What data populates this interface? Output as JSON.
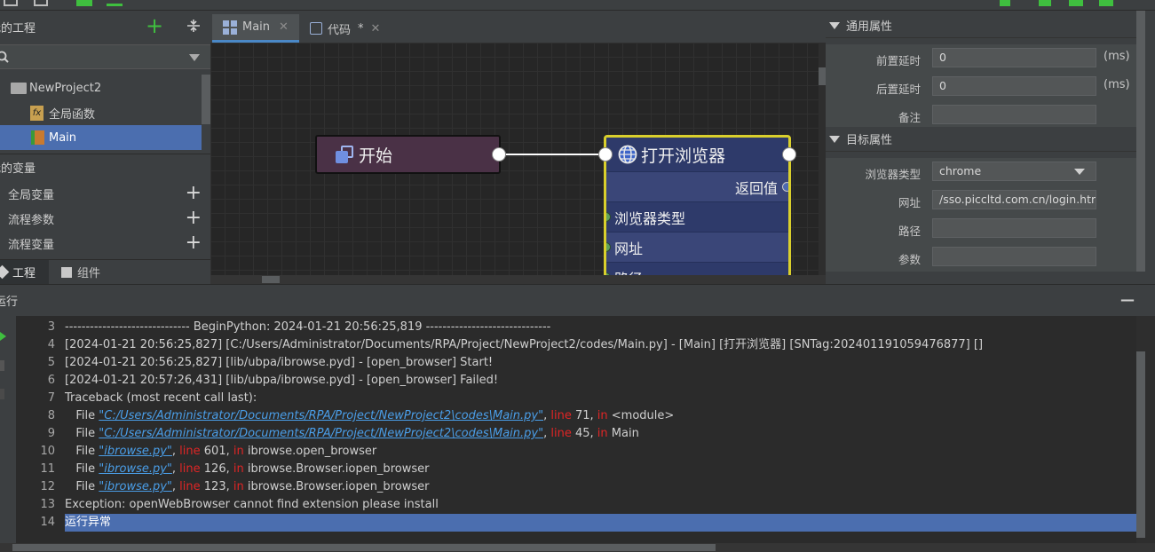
{
  "left_panel": {
    "project_header": "我的工程",
    "tree": [
      {
        "label": "NewProject2",
        "icon": "folder-icon"
      },
      {
        "label": "全局函数",
        "icon": "function-icon"
      },
      {
        "label": "Main",
        "icon": "flow-icon",
        "selected": true
      }
    ],
    "variables_header": "我的变量",
    "variables": [
      {
        "label": "全局变量"
      },
      {
        "label": "流程参数"
      },
      {
        "label": "流程变量"
      }
    ],
    "bottom_tabs": [
      {
        "label": "工程"
      },
      {
        "label": "组件"
      }
    ]
  },
  "editor_tabs": [
    {
      "label": "Main",
      "close": "✕"
    },
    {
      "label": "代码",
      "modified": "*",
      "close": "✕"
    }
  ],
  "nodes": {
    "start": {
      "label": "开始"
    },
    "browser": {
      "title": "打开浏览器",
      "output_port": "返回值",
      "inputs": [
        "浏览器类型",
        "网址",
        "路径"
      ]
    }
  },
  "properties": {
    "general_header": "通用属性",
    "general": [
      {
        "label": "前置延时",
        "value": "0",
        "unit": "(ms)"
      },
      {
        "label": "后置延时",
        "value": "0",
        "unit": "(ms)"
      },
      {
        "label": "备注",
        "value": ""
      }
    ],
    "target_header": "目标属性",
    "target": [
      {
        "label": "浏览器类型",
        "value": "chrome"
      },
      {
        "label": "网址",
        "value": "/sso.piccltd.com.cn/login.html'"
      },
      {
        "label": "路径",
        "value": ""
      },
      {
        "label": "参数",
        "value": ""
      }
    ]
  },
  "output": {
    "title": "运行",
    "minimize": "—",
    "lines": [
      {
        "n": "3",
        "text": "------------------------------ BeginPython: 2024-01-21 20:56:25,819 ------------------------------"
      },
      {
        "n": "4",
        "text": "[2024-01-21 20:56:25,827] [C:/Users/Administrator/Documents/RPA/Project/NewProject2/codes/Main.py] - [Main] [打开浏览器] [SNTag:202401191059476877] []"
      },
      {
        "n": "5",
        "text": "[2024-01-21 20:56:25,827] [lib/ubpa/ibrowse.pyd] - [open_browser] Start!"
      },
      {
        "n": "6",
        "text": "[2024-01-21 20:57:26,431] [lib/ubpa/ibrowse.pyd] - [open_browser] Failed!"
      },
      {
        "n": "7",
        "text": "Traceback (most recent call last):"
      },
      {
        "n": "8",
        "pre": "   File ",
        "link": "\"C:/Users/Administrator/Documents/RPA/Project/NewProject2\\codes\\Main.py\"",
        "mid": ", ",
        "kw1": "line",
        "num": " 71, ",
        "kw2": "in",
        "post": " <module>"
      },
      {
        "n": "9",
        "pre": "   File ",
        "link": "\"C:/Users/Administrator/Documents/RPA/Project/NewProject2\\codes\\Main.py\"",
        "mid": ", ",
        "kw1": "line",
        "num": " 45, ",
        "kw2": "in",
        "post": " Main"
      },
      {
        "n": "10",
        "pre": "   File ",
        "link": "\"ibrowse.py\"",
        "mid": ", ",
        "kw1": "line",
        "num": " 601, ",
        "kw2": "in",
        "post": " ibrowse.open_browser"
      },
      {
        "n": "11",
        "pre": "   File ",
        "link": "\"ibrowse.py\"",
        "mid": ", ",
        "kw1": "line",
        "num": " 126, ",
        "kw2": "in",
        "post": " ibrowse.Browser.iopen_browser"
      },
      {
        "n": "12",
        "pre": "   File ",
        "link": "\"ibrowse.py\"",
        "mid": ", ",
        "kw1": "line",
        "num": " 123, ",
        "kw2": "in",
        "post": " ibrowse.Browser.iopen_browser"
      },
      {
        "n": "13",
        "text": "Exception: openWebBrowser cannot find extension please install"
      },
      {
        "n": "14",
        "text": "运行异常",
        "selected": true
      }
    ]
  },
  "colors": {
    "accent": "#4b6eaf",
    "node_highlight": "#d9cf2c",
    "run_green": "#3fbf3f",
    "error_red": "#e02525",
    "link_blue": "#4a9ee8"
  }
}
